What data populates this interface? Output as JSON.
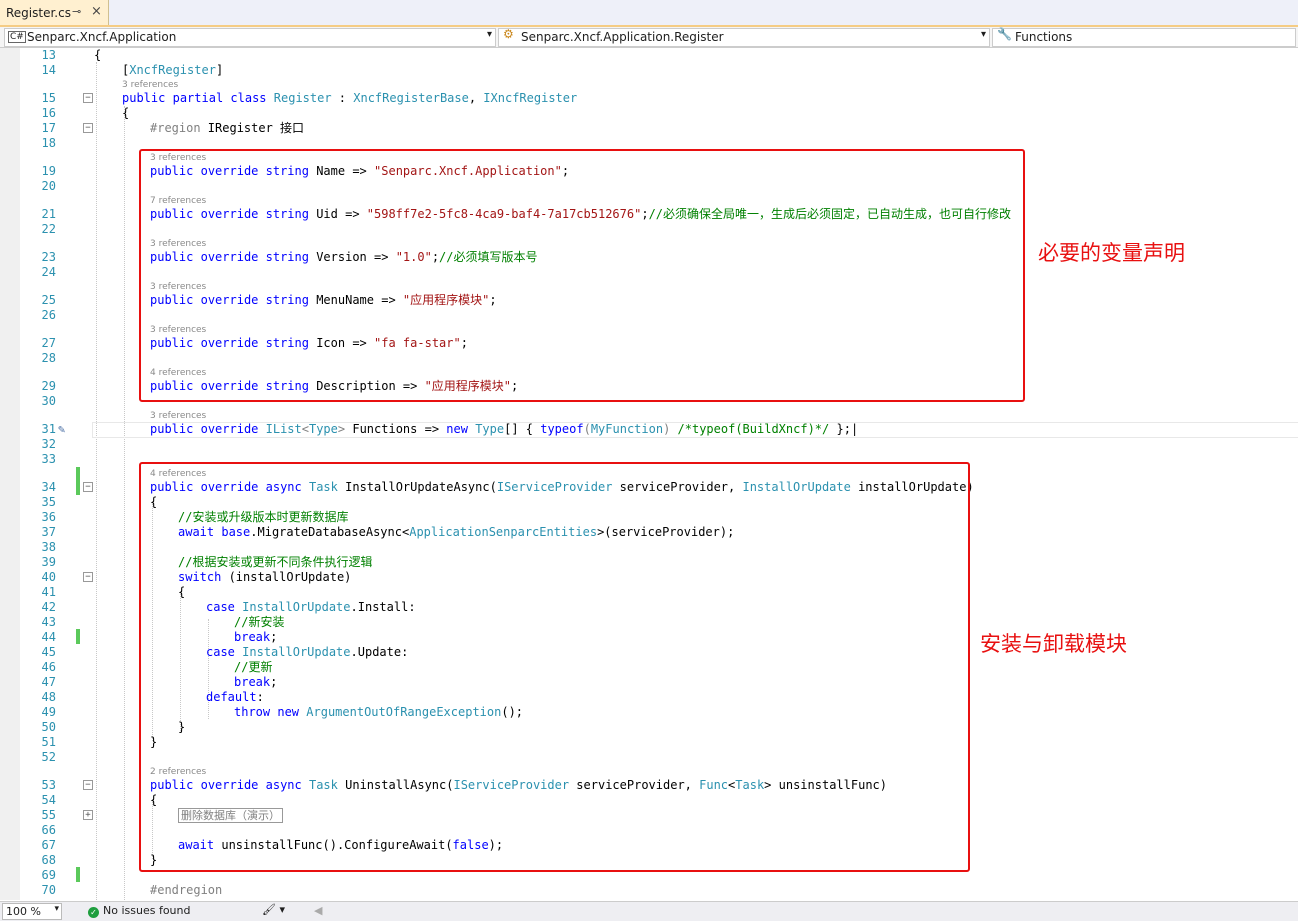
{
  "tab": {
    "name": "Register.cs",
    "pin": "⊸",
    "close": "×"
  },
  "nav": {
    "project": "Senparc.Xncf.Application",
    "class": "Senparc.Xncf.Application.Register",
    "member": "Functions"
  },
  "lines": {
    "l13": {
      "n": "13"
    },
    "l14": {
      "n": "14"
    },
    "l15": {
      "n": "15"
    },
    "l16": {
      "n": "16"
    },
    "l17": {
      "n": "17"
    },
    "l18": {
      "n": "18"
    },
    "l19": {
      "n": "19"
    },
    "l20": {
      "n": "20"
    },
    "l21": {
      "n": "21"
    },
    "l22": {
      "n": "22"
    },
    "l23": {
      "n": "23"
    },
    "l24": {
      "n": "24"
    },
    "l25": {
      "n": "25"
    },
    "l26": {
      "n": "26"
    },
    "l27": {
      "n": "27"
    },
    "l28": {
      "n": "28"
    },
    "l29": {
      "n": "29"
    },
    "l30": {
      "n": "30"
    },
    "l31": {
      "n": "31"
    },
    "l32": {
      "n": "32"
    },
    "l33": {
      "n": "33"
    },
    "l34": {
      "n": "34"
    },
    "l35": {
      "n": "35"
    },
    "l36": {
      "n": "36"
    },
    "l37": {
      "n": "37"
    },
    "l38": {
      "n": "38"
    },
    "l39": {
      "n": "39"
    },
    "l40": {
      "n": "40"
    },
    "l41": {
      "n": "41"
    },
    "l42": {
      "n": "42"
    },
    "l43": {
      "n": "43"
    },
    "l44": {
      "n": "44"
    },
    "l45": {
      "n": "45"
    },
    "l46": {
      "n": "46"
    },
    "l47": {
      "n": "47"
    },
    "l48": {
      "n": "48"
    },
    "l49": {
      "n": "49"
    },
    "l50": {
      "n": "50"
    },
    "l51": {
      "n": "51"
    },
    "l52": {
      "n": "52"
    },
    "l53": {
      "n": "53"
    },
    "l54": {
      "n": "54"
    },
    "l55": {
      "n": "55"
    },
    "l66": {
      "n": "66"
    },
    "l67": {
      "n": "67"
    },
    "l68": {
      "n": "68"
    },
    "l69": {
      "n": "69"
    },
    "l70": {
      "n": "70"
    }
  },
  "refs": {
    "class": "3 references",
    "name": "3 references",
    "uid": "7 references",
    "version": "3 references",
    "menu": "3 references",
    "icon": "3 references",
    "desc": "4 references",
    "functions": "3 references",
    "install": "4 references",
    "uninstall": "2 references"
  },
  "code": {
    "attr_open": "[",
    "attr_name": "XncfRegister",
    "attr_close": "]",
    "kw_public": "public",
    "kw_partial": "partial",
    "kw_class": "class",
    "kw_override": "override",
    "kw_string": "string",
    "kw_async": "async",
    "kw_new": "new",
    "kw_typeof": "typeof",
    "kw_await": "await",
    "kw_base": "base",
    "kw_switch": "switch",
    "kw_case": "case",
    "kw_break": "break",
    "kw_default": "default",
    "kw_throw": "throw",
    "kw_false": "false",
    "class_name": "Register",
    "colon": " : ",
    "base1": "XncfRegisterBase",
    "comma": ", ",
    "base2": "IXncfRegister",
    "brace_open": "{",
    "brace_close": "}",
    "region": "#region",
    "region_name": " IRegister 接口",
    "endregion": "#endregion",
    "name_decl": " Name => ",
    "name_val": "\"Senparc.Xncf.Application\"",
    "semi": ";",
    "uid_decl": " Uid => ",
    "uid_val": "\"598ff7e2-5fc8-4ca9-baf4-7a17cb512676\"",
    "uid_cm": "//必须确保全局唯一，生成后必须固定，已自动生成，也可自行修改",
    "ver_decl": " Version => ",
    "ver_val": "\"1.0\"",
    "ver_cm": "//必须填写版本号",
    "menu_decl": " MenuName => ",
    "menu_val": "\"应用程序模块\"",
    "icon_decl": " Icon => ",
    "icon_val": "\"fa fa-star\"",
    "desc_decl": " Description => ",
    "desc_val": "\"应用程序模块\"",
    "ilist": "IList",
    "lt": "<",
    "type": "Type",
    "gt": ">",
    "func_decl": " Functions => ",
    "type_arr": "Type",
    "arr_open": "[] { ",
    "myfunc_open": "(",
    "myfunc": "MyFunction",
    "myfunc_close": ") ",
    "func_cm": "/*typeof(BuildXncf)*/",
    " func_end": " };",
    "caret": "|",
    "task": "Task",
    "install_name": " InstallOrUpdateAsync(",
    "isp": "IServiceProvider",
    "sp_param": " serviceProvider, ",
    "iou": "InstallOrUpdate",
    "iou_param": " installOrUpdate)",
    "cm_upgrade": "//安装或升级版本时更新数据库",
    "migrate": ".MigrateDatabaseAsync<",
    "entities": "ApplicationSenparcEntities",
    "migrate_end": ">(serviceProvider);",
    "cm_exec": "//根据安装或更新不同条件执行逻辑",
    "switch_arg": " (installOrUpdate)",
    "install_member": ".Install:",
    "cm_new": "//新安装",
    "update_member": ".Update:",
    "cm_update": "//更新",
    "default_colon": ":",
    "exception": "ArgumentOutOfRangeException",
    "exc_end": "();",
    "uninstall_name": " UninstallAsync(",
    "func_type": "Func",
    "uninst_param": "> unsinstallFunc)",
    "collapsed": "删除数据库（演示）",
    "await_uninst": " unsinstallFunc().ConfigureAwait(",
    "await_end": ");"
  },
  "notes": {
    "vars": "必要的变量声明",
    "install": "安装与卸载模块"
  },
  "status": {
    "zoom": "100 %",
    "issues": "No issues found"
  },
  "colors": {
    "annotation": "#e81010",
    "keyword": "#0000ff",
    "type": "#2b91af",
    "string": "#a31515",
    "comment": "#008000",
    "change_bar": "#5bc95b"
  }
}
